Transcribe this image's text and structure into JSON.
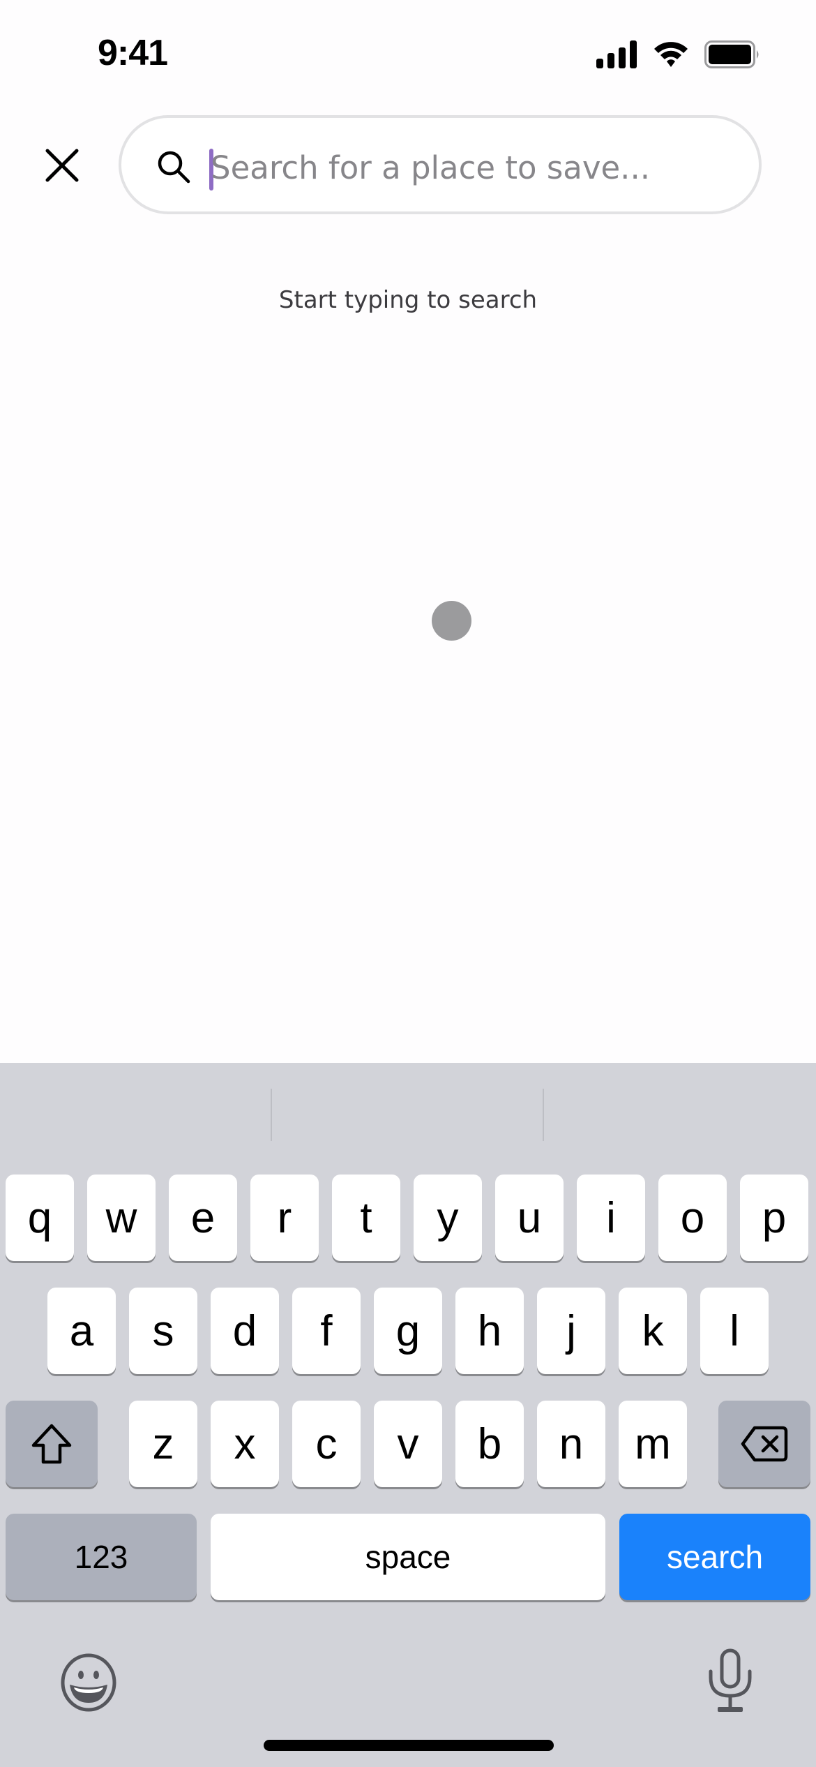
{
  "status_bar": {
    "time": "9:41",
    "icons": [
      "cellular-signal-icon",
      "wifi-icon",
      "battery-icon"
    ]
  },
  "header": {
    "close_icon": "close-icon",
    "search": {
      "icon": "search-icon",
      "value": "",
      "placeholder": "Search for a place to save...",
      "caret_color": "#8e6cc4"
    }
  },
  "main": {
    "hint_text": "Start typing to search",
    "touch_indicator_color": "#9b9b9d"
  },
  "keyboard": {
    "rows": [
      [
        "q",
        "w",
        "e",
        "r",
        "t",
        "y",
        "u",
        "i",
        "o",
        "p"
      ],
      [
        "a",
        "s",
        "d",
        "f",
        "g",
        "h",
        "j",
        "k",
        "l"
      ],
      [
        "z",
        "x",
        "c",
        "v",
        "b",
        "n",
        "m"
      ]
    ],
    "shift_icon": "shift-icon",
    "delete_icon": "delete-backspace-icon",
    "numbers_label": "123",
    "space_label": "space",
    "return_label": "search",
    "return_color": "#1a82fb",
    "emoji_icon": "emoji-icon",
    "mic_icon": "microphone-icon"
  }
}
